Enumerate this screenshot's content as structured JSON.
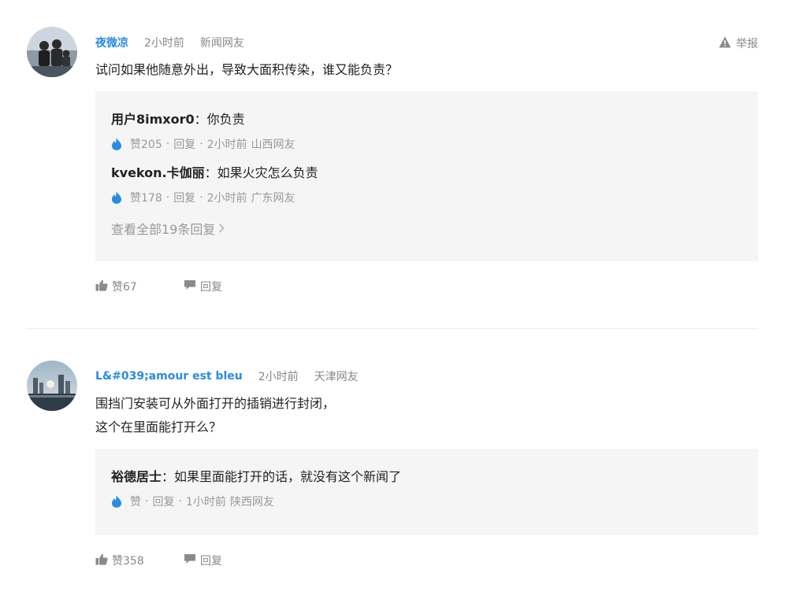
{
  "comments": [
    {
      "username": "夜微凉",
      "time": "2小时前",
      "region": "新闻网友",
      "report_label": "举报",
      "content": "试问如果他随意外出，导致大面积传染，谁又能负责？",
      "replies": [
        {
          "user": "用户8imxor0",
          "sep": "：",
          "text": "你负责",
          "likes": "赞205",
          "reply_label": "回复",
          "time": "2小时前",
          "region": "山西网友"
        },
        {
          "user": "kvekon.卡伽丽",
          "sep": "：",
          "text": "如果火灾怎么负责",
          "likes": "赞178",
          "reply_label": "回复",
          "time": "2小时前",
          "region": "广东网友"
        }
      ],
      "view_all": "查看全部19条回复",
      "likes": "赞67",
      "reply_label": "回复"
    },
    {
      "username": "L&#039;amour est bleu",
      "time": "2小时前",
      "region": "天津网友",
      "content_lines": [
        "围挡门安装可从外面打开的插销进行封闭，",
        "这个在里面能打开么？"
      ],
      "replies": [
        {
          "user": "裕德居士",
          "sep": "：",
          "text": "如果里面能打开的话，就没有这个新闻了",
          "likes": "赞",
          "reply_label": "回复",
          "time": "1小时前",
          "region": "陕西网友"
        }
      ],
      "likes": "赞358",
      "reply_label": "回复"
    }
  ],
  "colors": {
    "username": "#2a8be0",
    "flame": "#2a8be0",
    "muted": "#888888",
    "reply_bg": "#f5f5f5"
  },
  "icons": [
    "warning-icon",
    "flame-icon",
    "thumbs-up-icon",
    "comment-icon",
    "chevron-right-icon"
  ]
}
